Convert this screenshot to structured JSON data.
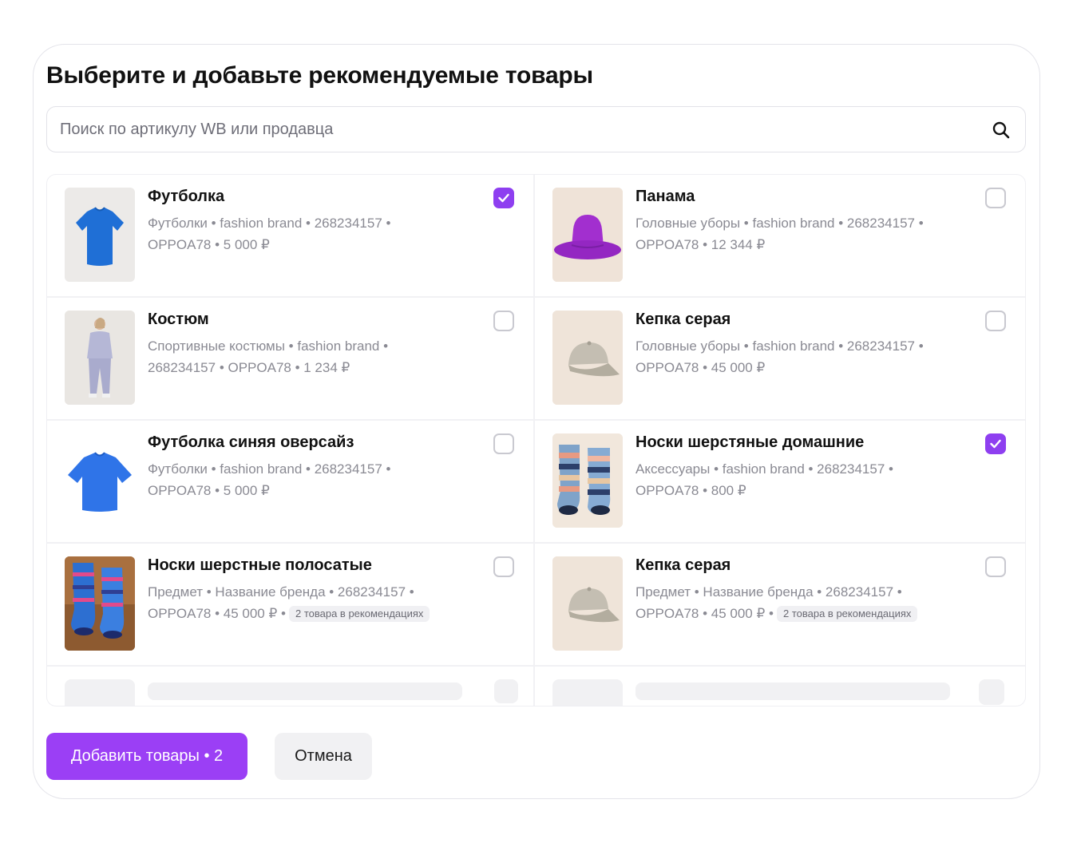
{
  "dialog": {
    "title": "Выберите и добавьте рекомендуемые товары"
  },
  "search": {
    "placeholder": "Поиск по артикулу WB или продавца",
    "icon": "search-icon"
  },
  "products": [
    {
      "name": "Футболка",
      "meta_line1": "Футболки • fashion brand • 268234157 •",
      "meta_line2": "OPPOA78 • 5 000 ₽",
      "tag": "",
      "checked": true,
      "image": "blue-tshirt"
    },
    {
      "name": "Панама",
      "meta_line1": "Головные уборы • fashion brand • 268234157 •",
      "meta_line2": "OPPOA78 • 12 344 ₽",
      "tag": "",
      "checked": false,
      "image": "purple-bucket-hat"
    },
    {
      "name": "Костюм",
      "meta_line1": "Спортивные костюмы • fashion brand •",
      "meta_line2": "268234157 • OPPOA78 • 1 234 ₽",
      "tag": "",
      "checked": false,
      "image": "tracksuit-model"
    },
    {
      "name": "Кепка серая",
      "meta_line1": "Головные уборы • fashion brand • 268234157 •",
      "meta_line2": "OPPOA78 • 45 000 ₽",
      "tag": "",
      "checked": false,
      "image": "grey-cap"
    },
    {
      "name": "Футболка синяя оверсайз",
      "meta_line1": "Футболки • fashion brand • 268234157 •",
      "meta_line2": "OPPOA78 • 5 000 ₽",
      "tag": "",
      "checked": false,
      "image": "blue-oversize-tshirt"
    },
    {
      "name": "Носки шерстяные домашние",
      "meta_line1": "Аксессуары • fashion brand • 268234157 •",
      "meta_line2": "OPPOA78 • 800 ₽",
      "tag": "",
      "checked": true,
      "image": "striped-socks"
    },
    {
      "name": "Носки шерстные полосатые",
      "meta_line1": "Предмет • Название бренда • 268234157 •",
      "meta_line2": "OPPOA78 • 45 000 ₽ •",
      "tag": "2 товара в рекомендациях",
      "checked": false,
      "image": "patterned-socks"
    },
    {
      "name": "Кепка серая",
      "meta_line1": "Предмет • Название бренда • 268234157 •",
      "meta_line2": "OPPOA78 • 45 000 ₽ •",
      "tag": "2 товара в рекомендациях",
      "checked": false,
      "image": "grey-cap"
    }
  ],
  "actions": {
    "add_label": "Добавить товары • 2",
    "cancel_label": "Отмена"
  },
  "colors": {
    "accent": "#9b3ff5",
    "checkbox_checked": "#8e3ff0"
  }
}
